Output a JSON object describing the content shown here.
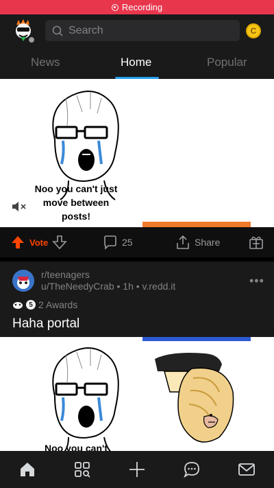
{
  "recording": {
    "label": "Recording"
  },
  "header": {
    "search_placeholder": "Search",
    "coin_symbol": "C"
  },
  "tabs": [
    {
      "label": "News",
      "active": false
    },
    {
      "label": "Home",
      "active": true
    },
    {
      "label": "Popular",
      "active": false
    }
  ],
  "post1": {
    "caption": "Noo you can't just move between posts!",
    "vote_label": "Vote",
    "comments": "25",
    "share_label": "Share"
  },
  "post2": {
    "subreddit": "r/teenagers",
    "meta": "u/TheNeedyCrab • 1h • v.redd.it",
    "awards": "2 Awards",
    "award_count_badge": "5",
    "title": "Haha portal",
    "caption": "Noo you can't"
  },
  "colors": {
    "accent": "#24a0ed",
    "upvote": "#ff4500",
    "recording": "#e8364d"
  },
  "bottom_nav": [
    "home-icon",
    "discover-icon",
    "create-icon",
    "chat-icon",
    "inbox-icon"
  ]
}
